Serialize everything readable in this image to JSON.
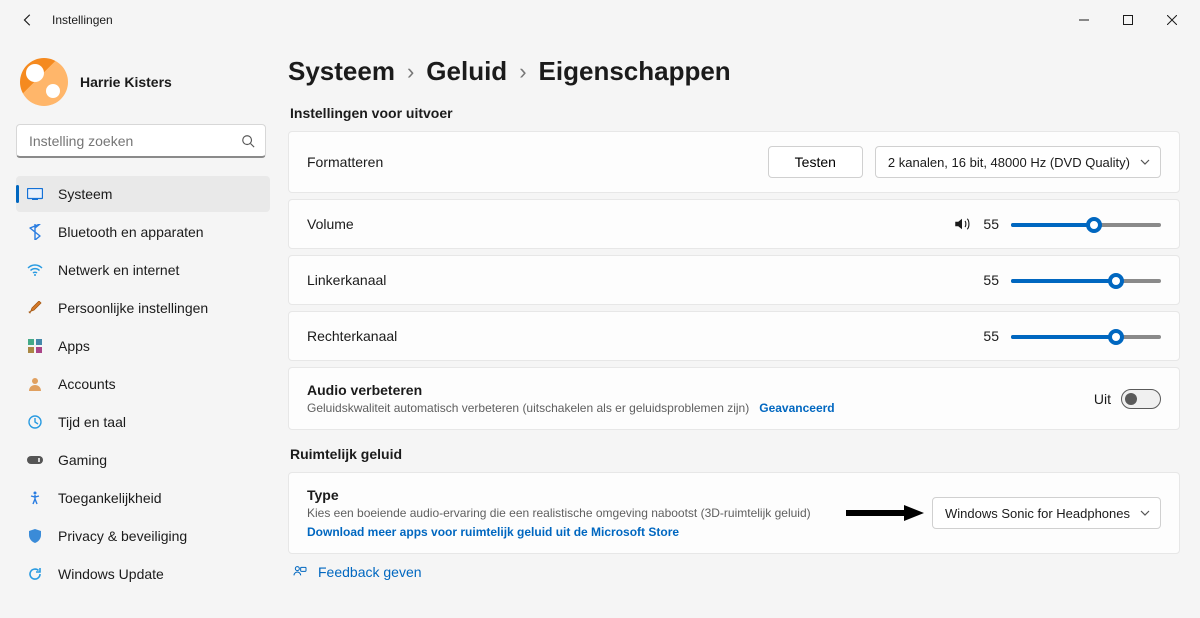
{
  "window": {
    "title": "Instellingen"
  },
  "account": {
    "name": "Harrie Kisters"
  },
  "search": {
    "placeholder": "Instelling zoeken"
  },
  "nav": [
    {
      "icon": "system",
      "label": "Systeem",
      "active": true
    },
    {
      "icon": "bluetooth",
      "label": "Bluetooth en apparaten"
    },
    {
      "icon": "wifi",
      "label": "Netwerk en internet"
    },
    {
      "icon": "brush",
      "label": "Persoonlijke instellingen"
    },
    {
      "icon": "apps",
      "label": "Apps"
    },
    {
      "icon": "person",
      "label": "Accounts"
    },
    {
      "icon": "clock",
      "label": "Tijd en taal"
    },
    {
      "icon": "game",
      "label": "Gaming"
    },
    {
      "icon": "access",
      "label": "Toegankelijkheid"
    },
    {
      "icon": "shield",
      "label": "Privacy & beveiliging"
    },
    {
      "icon": "update",
      "label": "Windows Update"
    }
  ],
  "breadcrumb": [
    "Systeem",
    "Geluid",
    "Eigenschappen"
  ],
  "sections": {
    "output": {
      "heading": "Instellingen voor uitvoer",
      "format": {
        "label": "Formatteren",
        "test_label": "Testen",
        "value": "2 kanalen, 16 bit, 48000 Hz (DVD Quality)"
      },
      "volume": {
        "label": "Volume",
        "value": "55",
        "percent": 55
      },
      "left": {
        "label": "Linkerkanaal",
        "value": "55",
        "percent": 70
      },
      "right": {
        "label": "Rechterkanaal",
        "value": "55",
        "percent": 70
      },
      "enhance": {
        "title": "Audio verbeteren",
        "desc": "Geluidskwaliteit automatisch verbeteren (uitschakelen als er geluidsproblemen zijn)",
        "adv": "Geavanceerd",
        "toggle_label": "Uit",
        "toggle_on": false
      }
    },
    "spatial": {
      "heading": "Ruimtelijk geluid",
      "type_title": "Type",
      "type_desc": "Kies een boeiende audio-ervaring die een realistische omgeving nabootst (3D-ruimtelijk geluid)",
      "download_link": "Download meer apps voor ruimtelijk geluid uit de Microsoft Store",
      "dropdown_value": "Windows Sonic for Headphones"
    }
  },
  "feedback": {
    "label": "Feedback geven"
  }
}
